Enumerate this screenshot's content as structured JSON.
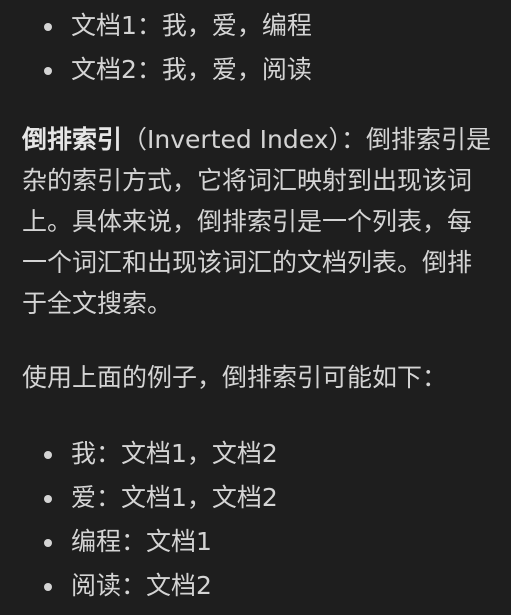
{
  "top_list": [
    {
      "text": "文档1：我，爱，编程"
    },
    {
      "text": "文档2：我，爱，阅读"
    }
  ],
  "definition": {
    "term": "倒排索引",
    "line1_rest": "（Inverted Index）：倒排索引是",
    "line2": "杂的索引方式，它将词汇映射到出现该词",
    "line3": "上。具体来说，倒排索引是一个列表，每",
    "line4": "一个词汇和出现该词汇的文档列表。倒排",
    "line5": "于全文搜索。"
  },
  "example_intro": "使用上面的例子，倒排索引可能如下：",
  "bottom_list": [
    {
      "text": "我：文档1，文档2"
    },
    {
      "text": "爱：文档1，文档2"
    },
    {
      "text": "编程：文档1"
    },
    {
      "text": "阅读：文档2"
    }
  ]
}
